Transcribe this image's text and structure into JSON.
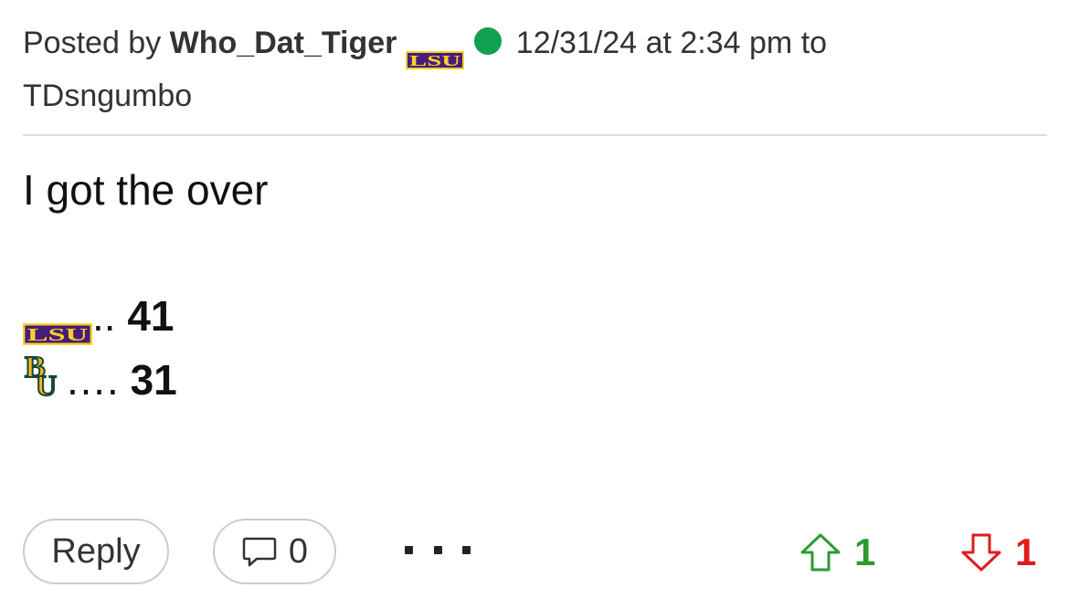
{
  "post": {
    "posted_by_prefix": "Posted by",
    "username": "Who_Dat_Tiger",
    "user_team_icon": "lsu-logo-icon",
    "online_status": "online",
    "timestamp": "12/31/24 at 2:34 pm",
    "to_prefix": "to",
    "reply_to_user": "TDsngumbo",
    "body_text": "I got the over",
    "predictions": [
      {
        "team_icon": "lsu-logo-icon",
        "dots": "..",
        "score": "41"
      },
      {
        "team_icon": "baylor-logo-icon",
        "dots": "….",
        "score": "31"
      }
    ]
  },
  "actions": {
    "reply_label": "Reply",
    "comment_count": "0",
    "more_label": "more-options",
    "upvote_count": "1",
    "downvote_count": "1"
  },
  "colors": {
    "online": "#10a050",
    "upvote": "#2e9a2e",
    "downvote": "#e11b1b",
    "lsu_purple": "#461d7c",
    "lsu_gold": "#fdd023",
    "baylor_green": "#154734",
    "baylor_gold": "#ffb81c"
  }
}
